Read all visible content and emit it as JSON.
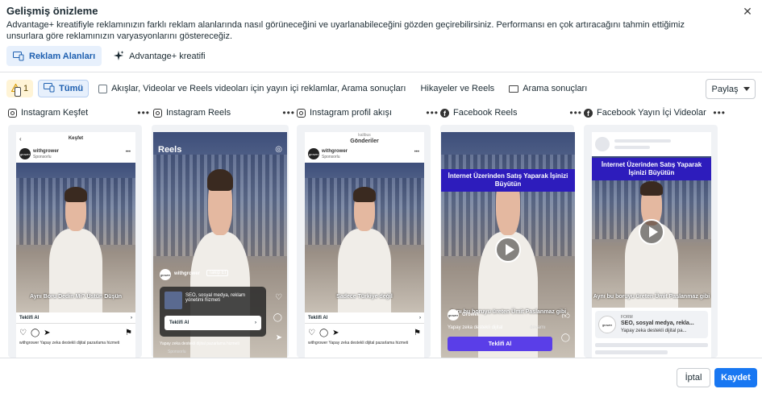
{
  "dialog": {
    "title": "Gelişmiş önizleme",
    "description": "Advantage+ kreatifiyle reklamınızın farklı reklam alanlarında nasıl görüneceğini ve uyarlanabileceğini gözden geçirebilirsiniz. Performansı en çok artıracağını tahmin ettiğimiz unsurlara göre reklamınızın varyasyonlarını göstereceğiz.",
    "close": "✕"
  },
  "view_tabs": [
    {
      "label": "Reklam Alanları",
      "active": true
    },
    {
      "label": "Advantage+ kreatifi",
      "active": false
    }
  ],
  "filters": {
    "warning_count": "1",
    "all_label": "Tümü",
    "options": [
      "Akışlar, Videolar ve Reels videoları için yayın içi reklamlar, Arama sonuçları",
      "Hikayeler ve Reels",
      "Arama sonuçları"
    ],
    "share_label": "Paylaş"
  },
  "placements": [
    {
      "name": "Instagram Keşfet",
      "platform": "instagram",
      "screen_title": "Keşfet",
      "account": "withgrower",
      "sponsored": "Sponsorlu",
      "caption": "Aynı Boru Dedin Mi? Üstün Düşün",
      "cta": "Teklifi Al",
      "body_text": "withgrower Yapay zeka destekli dijital pazarlama hizmeti"
    },
    {
      "name": "Instagram Reels",
      "platform": "instagram",
      "reels_label": "Reels",
      "account": "withgrower",
      "follow": "Takip Et",
      "card_text": "SEO, sosyal medya, reklam yönetimi hizmeti",
      "cta": "Teklifi Al",
      "body_text": "Yapay zeka destekli dijital pazarlama hizmeti",
      "sponsored": "Sponsorlu"
    },
    {
      "name": "Instagram profil akışı",
      "platform": "instagram",
      "profile_handle": "kalibus",
      "screen_title": "Gönderiler",
      "account": "withgrower",
      "sponsored": "Sponsorlu",
      "caption": "Sadece Türkiye değil",
      "cta": "Teklifi Al",
      "body_text": "withgrower Yapay zeka destekli dijital pazarlama hizmeti"
    },
    {
      "name": "Facebook Reels",
      "platform": "facebook",
      "banner": "İnternet Üzerinden Satış Yaparak İşinizi Büyütün",
      "account": "Grower",
      "caption": "Aynı bu boruyu üreten Ümit Paslanmaz gibi",
      "body_text": "Yapay zeka destekli dijital",
      "more": "devamı",
      "cta": "Teklifi Al"
    },
    {
      "name": "Facebook Yayın İçi Videolar",
      "platform": "facebook",
      "banner": "İnternet Üzerinden Satış Yaparak İşinizi Büyütün",
      "caption": "Aynı bu boruyu üreten Ümit Paslanmaz gibi",
      "form_label": "FORM",
      "form_title": "SEO, sosyal medya, rekla...",
      "form_desc": "Yapay zeka destekli dijital pa...",
      "logo_text": "grower"
    }
  ],
  "footer": {
    "cancel_label": "İptal",
    "save_label": "Kaydet"
  },
  "colors": {
    "accent": "#1877f2",
    "tab_active_bg": "#e7f0fc",
    "banner": "#2d1cbc",
    "warning_bg": "#fff4d6"
  }
}
